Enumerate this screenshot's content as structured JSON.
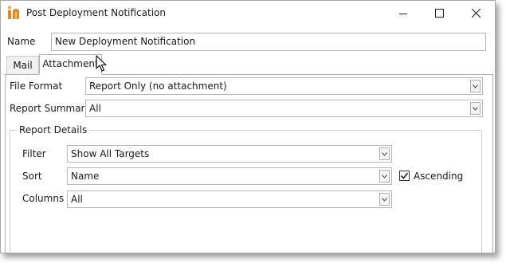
{
  "window": {
    "title": "Post Deployment Notification"
  },
  "name_field": {
    "label": "Name",
    "value": "New Deployment Notification"
  },
  "tabs": [
    {
      "label": "Mail",
      "active": false
    },
    {
      "label": "Attachment",
      "active": true
    }
  ],
  "attachment": {
    "file_format": {
      "label": "File Format",
      "value": "Report Only (no attachment)"
    },
    "report_summary": {
      "label": "Report Summary",
      "value": "All"
    }
  },
  "report_details": {
    "title": "Report Details",
    "filter": {
      "label": "Filter",
      "value": "Show All Targets"
    },
    "sort": {
      "label": "Sort",
      "value": "Name"
    },
    "ascending": {
      "label": "Ascending",
      "checked": true
    },
    "columns": {
      "label": "Columns",
      "value": "All"
    }
  },
  "colors": {
    "brand": "#e8891c",
    "border": "#b8b8b8"
  },
  "icons": [
    "app-logo-icon",
    "minimize-icon",
    "maximize-icon",
    "close-icon",
    "chevron-down-icon",
    "checkmark-icon",
    "mouse-cursor-icon"
  ]
}
